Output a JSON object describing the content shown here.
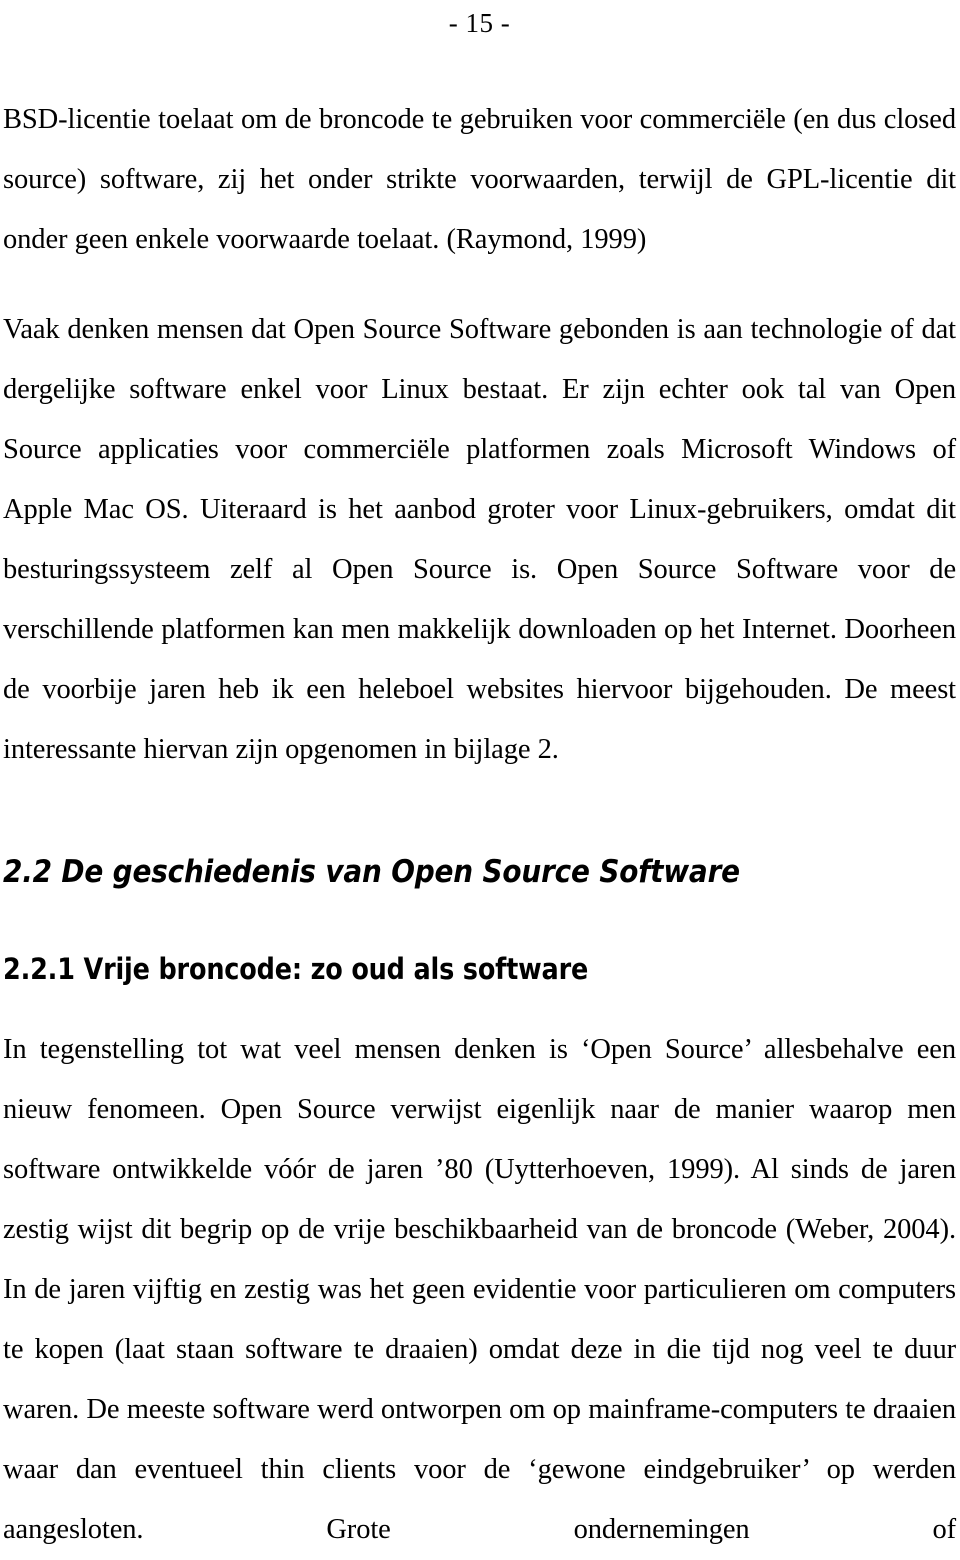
{
  "page": {
    "folio": "- 15 -",
    "background_color": "#ffffff",
    "text_color": "#000000"
  },
  "body": {
    "paragraphs": [
      {
        "id": "paragraph-bsd-licentie",
        "text": "BSD-licentie toelaat om de broncode te gebruiken voor commerciële (en dus closed source) software, zij het onder strikte voorwaarden, terwijl de GPL-licentie dit onder geen enkele voorwaarde toelaat. (Raymond, 1999)"
      },
      {
        "id": "paragraph-vaak-denken",
        "text": "Vaak denken mensen dat Open Source Software gebonden is aan technologie of dat dergelijke software enkel voor Linux bestaat. Er zijn echter ook tal van Open Source applicaties voor commerciële platformen zoals Microsoft Windows of Apple Mac OS. Uiteraard is het aanbod groter voor Linux-gebruikers, omdat dit besturingssysteem zelf al Open Source is. Open Source Software voor de verschillende platformen kan men makkelijk downloaden op het Internet. Doorheen de voorbije jaren heb ik een heleboel websites hiervoor bijgehouden. De meest interessante hiervan zijn opgenomen in bijlage 2."
      }
    ]
  },
  "headings": {
    "section": "2.2 De geschiedenis van Open Source Software",
    "subsection": "2.2.1 Vrije broncode: zo oud als software"
  },
  "body_after_headings": {
    "paragraphs": [
      {
        "id": "paragraph-in-tegenstelling",
        "text": "In tegenstelling tot wat veel mensen denken is ‘Open Source’ allesbehalve een nieuw fenomeen. Open Source verwijst eigenlijk naar de manier waarop men software ontwikkelde vóór de jaren ’80 (Uytterhoeven, 1999). Al sinds de jaren zestig wijst dit begrip op de vrije beschikbaarheid van de broncode (Weber, 2004). In de jaren vijftig en zestig was het geen evidentie voor particulieren om computers te kopen  (laat staan software te draaien) omdat deze in die tijd nog veel te duur waren. De meeste software werd ontworpen om op mainframe-computers te draaien waar dan eventueel thin clients voor de ‘gewone eindgebruiker’ op werden aangesloten. Grote ondernemingen of"
      }
    ]
  },
  "citations": [
    "(Raymond, 1999)",
    "(Uytterhoeven, 1999)",
    "(Weber, 2004)"
  ]
}
